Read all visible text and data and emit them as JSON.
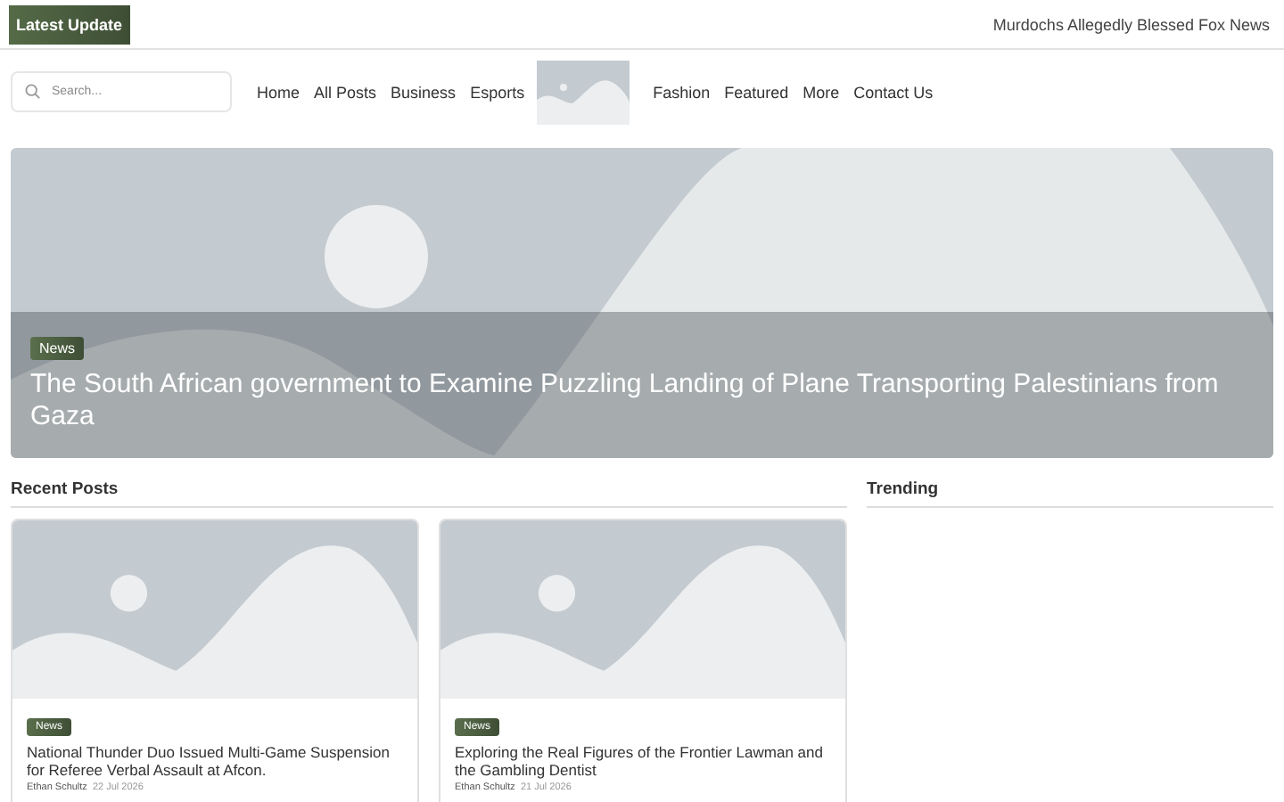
{
  "top_bar": {
    "badge": "Latest Update",
    "ticker": "Murdochs Allegedly Blessed Fox News"
  },
  "search": {
    "placeholder": "Search..."
  },
  "nav": [
    {
      "label": "Home",
      "kind": "link"
    },
    {
      "label": "All Posts",
      "kind": "link"
    },
    {
      "label": "Business",
      "kind": "link"
    },
    {
      "label": "Esports",
      "kind": "link"
    },
    {
      "kind": "logo"
    },
    {
      "label": "Fashion",
      "kind": "link"
    },
    {
      "label": "Featured",
      "kind": "link"
    },
    {
      "label": "More",
      "kind": "link"
    },
    {
      "label": "Contact Us",
      "kind": "link"
    }
  ],
  "hero": {
    "tag": "News",
    "title": "The South African government to Examine Puzzling Landing of Plane Transporting Palestinians from Gaza"
  },
  "sections": {
    "recent": "Recent Posts",
    "trending": "Trending"
  },
  "posts": [
    {
      "tag": "News",
      "title": "National Thunder Duo Issued Multi-Game Suspension for Referee Verbal Assault at Afcon.",
      "author": "Ethan Schultz",
      "date": "22 Jul 2026"
    },
    {
      "tag": "News",
      "title": "Exploring the Real Figures of the Frontier Lawman and the Gambling Dentist",
      "author": "Ethan Schultz",
      "date": "21 Jul 2026"
    }
  ]
}
